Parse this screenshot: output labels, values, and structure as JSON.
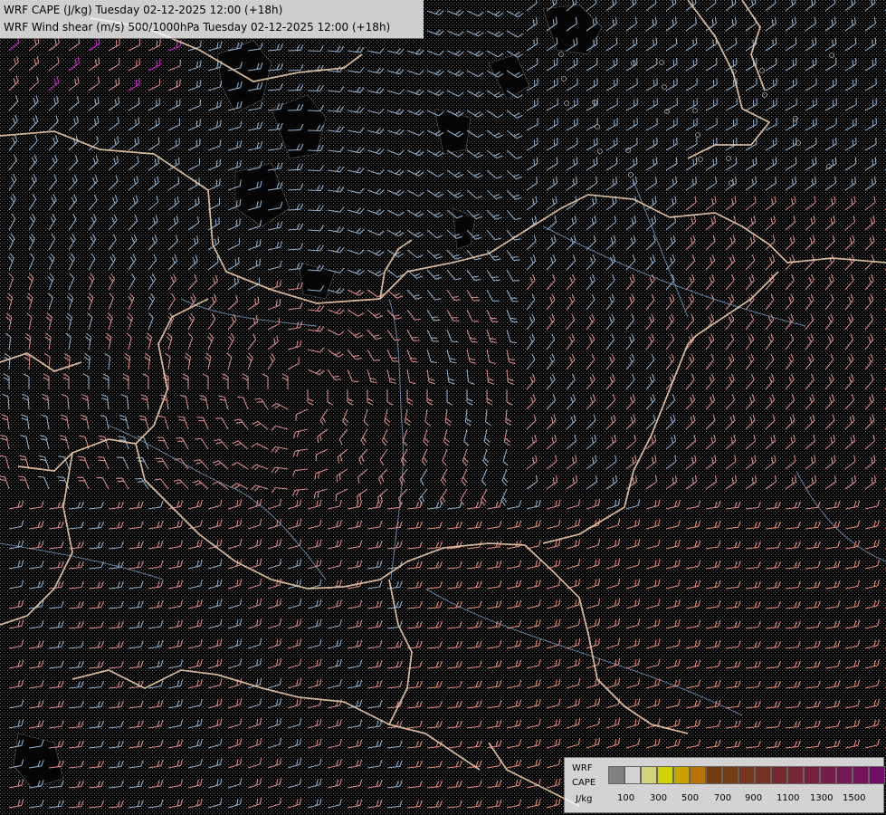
{
  "titles": {
    "line1": "WRF CAPE (J/kg) Tuesday 02-12-2025 12:00 (+18h)",
    "line2": "WRF Wind shear (m/s) 500/1000hPa Tuesday 02-12-2025 12:00 (+18h)"
  },
  "legend": {
    "word1": "WRF",
    "word2": "CAPE",
    "unit": "J/kg",
    "colors": [
      "#9a9a9a",
      "#ffffff",
      "#ffff99",
      "#ffff00",
      "#f3c400",
      "#e08a00",
      "#8b4513",
      "#8b4a18",
      "#8b4020",
      "#8c3a2a",
      "#8c3036",
      "#8c2b40",
      "#8c264b",
      "#8c2157",
      "#8b1b62",
      "#8b156e",
      "#8b0e7c"
    ],
    "ticks": [
      "100",
      "300",
      "500",
      "700",
      "900",
      "1100",
      "1300",
      "1500"
    ]
  },
  "map_colors": {
    "background": "#000000",
    "texture": "#6e6e6e",
    "barb_grey": "#aaaaaa",
    "barb_blue": "#8faeca",
    "barb_pink": "#d98a8a",
    "barb_salmon": "#e48a7a",
    "barb_magenta": "#e020e0",
    "border": "#e9c9a6",
    "river": "#6d8fb5",
    "terrain_dark": "#1a1a1a"
  }
}
